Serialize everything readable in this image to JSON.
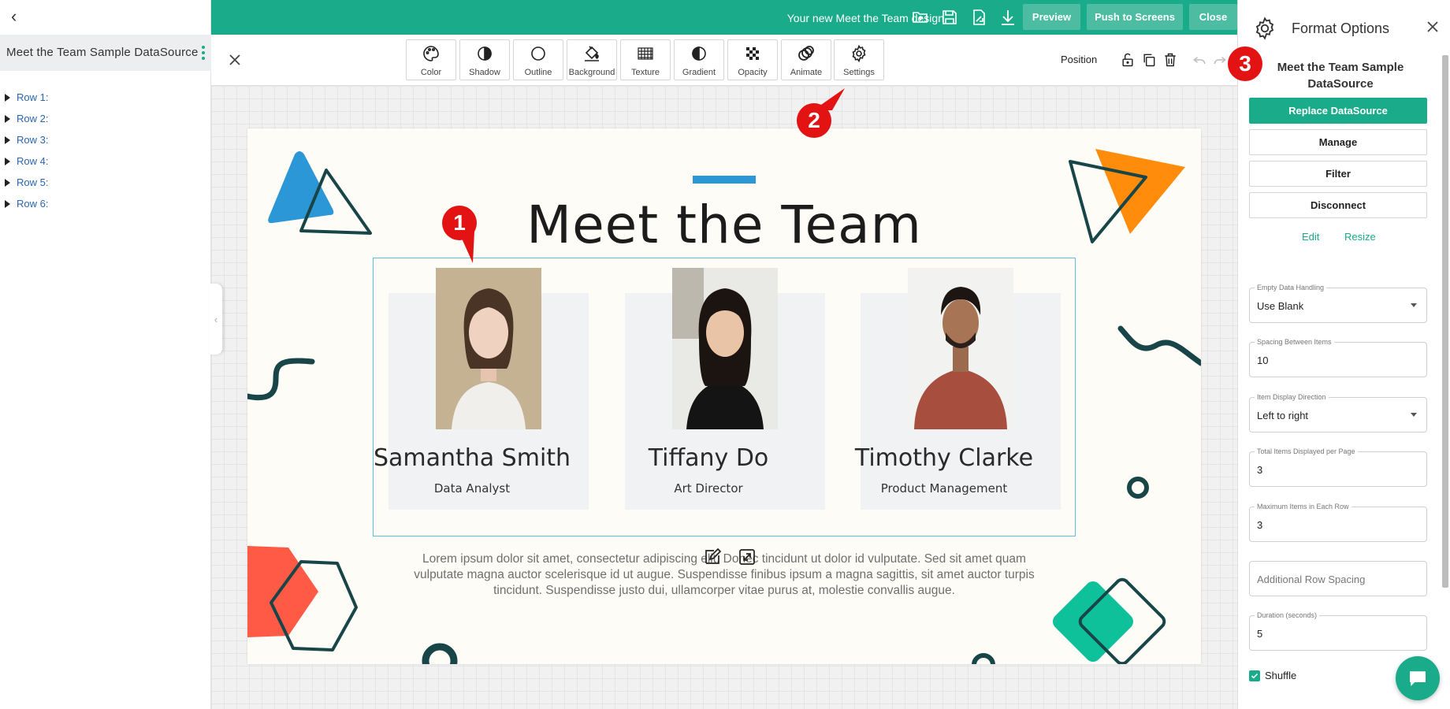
{
  "left_panel": {
    "datasource_title": "Meet the Team Sample DataSource",
    "rows": [
      "Row 1:",
      "Row 2:",
      "Row 3:",
      "Row 4:",
      "Row 5:",
      "Row 6:"
    ]
  },
  "topbar": {
    "design_name": "Your new Meet the Team design",
    "buttons": {
      "preview": "Preview",
      "push": "Push to Screens",
      "close": "Close"
    }
  },
  "toolbar": {
    "tools": [
      "Color",
      "Shadow",
      "Outline",
      "Background",
      "Texture",
      "Gradient",
      "Opacity",
      "Animate",
      "Settings"
    ],
    "position_label": "Position"
  },
  "design": {
    "title": "Meet the Team",
    "members": [
      {
        "name": "Samantha Smith",
        "role": "Data Analyst"
      },
      {
        "name": "Tiffany Do",
        "role": "Art Director"
      },
      {
        "name": "Timothy Clarke",
        "role": "Product Management"
      }
    ],
    "lorem": "Lorem ipsum dolor sit amet, consectetur adipiscing elit. Donec tincidunt ut dolor id vulputate. Sed sit amet quam vulputate magna auctor scelerisque id ut augue. Suspendisse finibus ipsum a magna sagittis, sit amet auctor turpis tincidunt. Suspendisse justo dui, ullamcorper vitae purus at, molestie convallis augue."
  },
  "markers": [
    "1",
    "2",
    "3"
  ],
  "right_panel": {
    "title": "Format Options",
    "datasource_name": "Meet the Team Sample DataSource",
    "buttons": {
      "replace": "Replace DataSource",
      "manage": "Manage",
      "filter": "Filter",
      "disconnect": "Disconnect"
    },
    "links": {
      "edit": "Edit",
      "resize": "Resize"
    },
    "fields": {
      "empty_data": {
        "label": "Empty Data Handling",
        "value": "Use Blank"
      },
      "spacing": {
        "label": "Spacing Between Items",
        "value": "10"
      },
      "direction": {
        "label": "Item Display Direction",
        "value": "Left to right"
      },
      "per_page": {
        "label": "Total Items Displayed per Page",
        "value": "3"
      },
      "per_row": {
        "label": "Maximum Items in Each Row",
        "value": "3"
      },
      "row_spacing": {
        "placeholder": "Additional Row Spacing"
      },
      "duration": {
        "label": "Duration (seconds)",
        "value": "5"
      }
    },
    "shuffle_label": "Shuffle",
    "shuffle_checked": true
  },
  "colors": {
    "brand": "#1aab8a",
    "accent_blue": "#2c97d6",
    "marker_red": "#e31313"
  }
}
